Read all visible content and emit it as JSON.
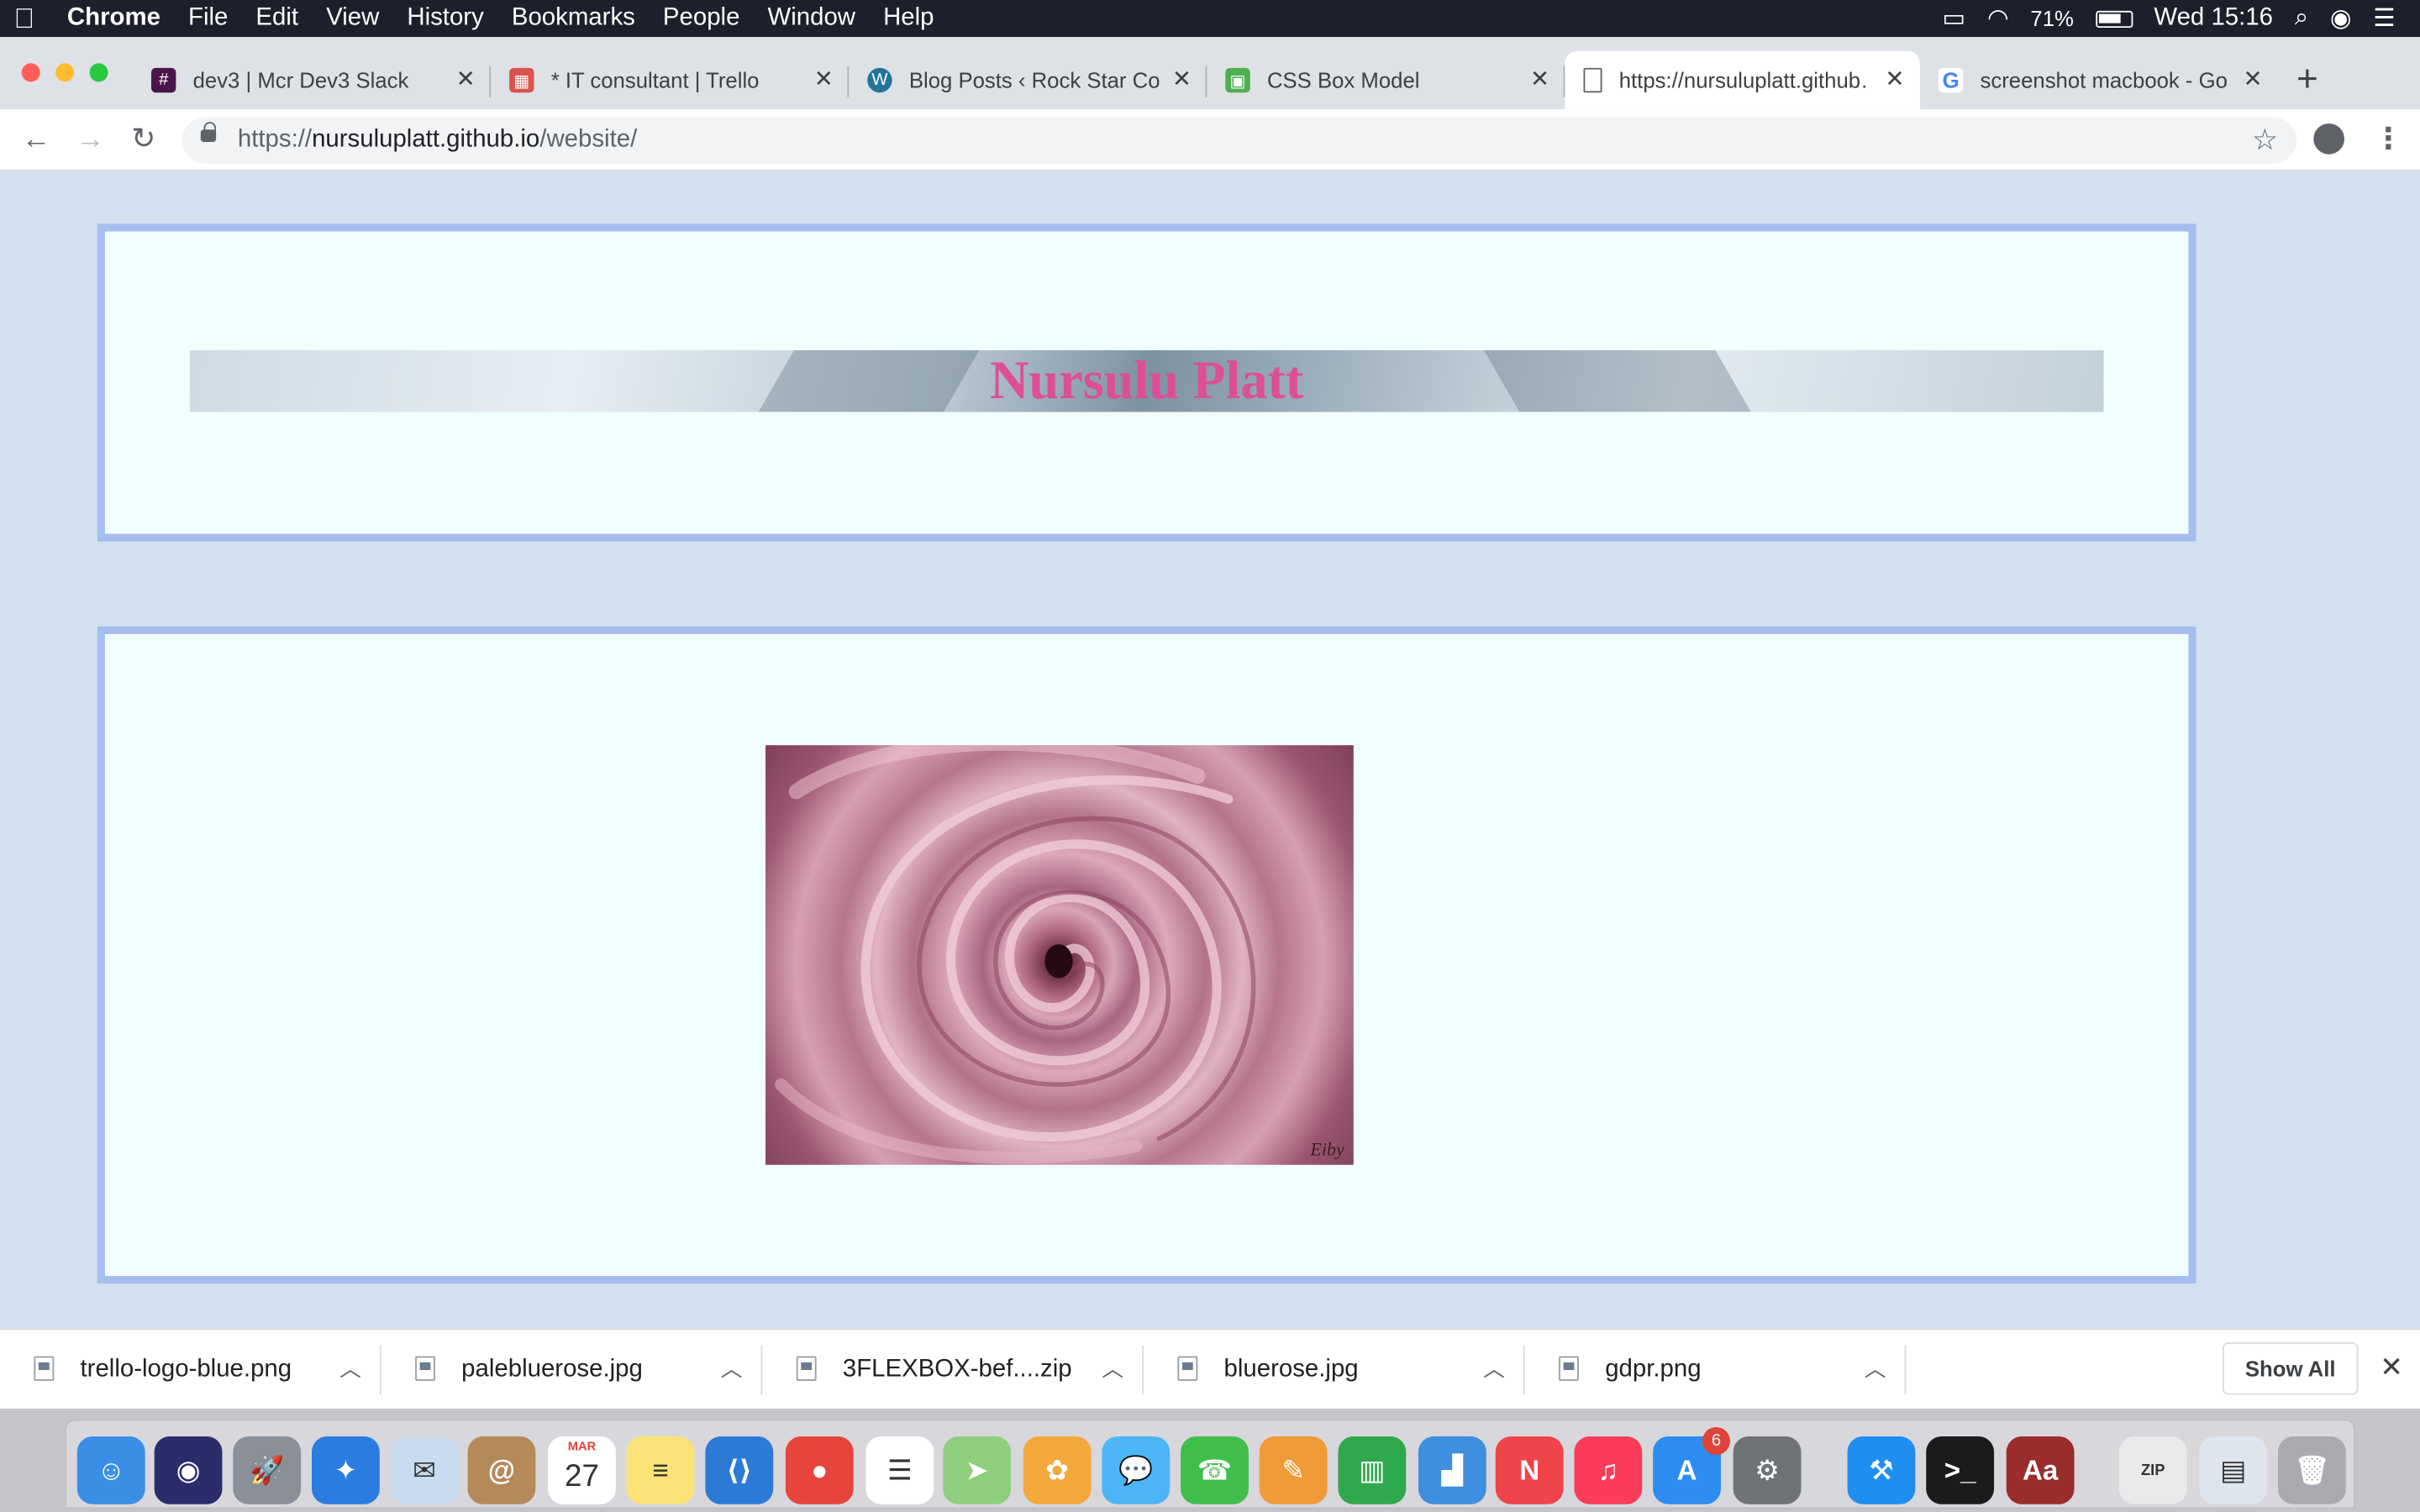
{
  "menubar": {
    "app": "Chrome",
    "items": [
      "File",
      "Edit",
      "View",
      "History",
      "Bookmarks",
      "People",
      "Window",
      "Help"
    ],
    "battery": "71%",
    "clock": "Wed 15:16"
  },
  "tabs": [
    {
      "title": "dev3 | Mcr Dev3 Slack",
      "icon": "slack-icon",
      "color": "#4a154b"
    },
    {
      "title": "* IT consultant | Trello",
      "icon": "trello-icon",
      "color": "#d9534f"
    },
    {
      "title": "Blog Posts ‹ Rock Star Co…",
      "icon": "wordpress-icon",
      "color": "#21759b"
    },
    {
      "title": "CSS Box Model",
      "icon": "box-model-icon",
      "color": "#4caf50"
    },
    {
      "title": "https://nursuluplatt.github…",
      "icon": "page-icon",
      "color": "#9aa0a6"
    },
    {
      "title": "screenshot macbook - Go…",
      "icon": "google-icon",
      "color": "#4285f4"
    }
  ],
  "omnibox": {
    "scheme": "https://",
    "host": "nursuluplatt.github.io",
    "path": "/website/"
  },
  "page": {
    "heading": "Nursulu Platt",
    "image_alt": "pink rose",
    "image_signature": "Eiby"
  },
  "downloads": {
    "items": [
      "trello-logo-blue.png",
      "palebluerose.jpg",
      "3FLEXBOX-bef....zip",
      "bluerose.jpg",
      "gdpr.png"
    ],
    "show_all": "Show All"
  },
  "dock": {
    "items": [
      {
        "name": "finder",
        "color": "#3a8ee6",
        "label": "☺"
      },
      {
        "name": "siri",
        "color": "#2b2d6b",
        "label": "◉"
      },
      {
        "name": "launchpad",
        "color": "#8b8f98",
        "label": "🚀"
      },
      {
        "name": "safari",
        "color": "#2b7ce0",
        "label": "✦"
      },
      {
        "name": "mail",
        "color": "#c9dcef",
        "label": "✉"
      },
      {
        "name": "contacts",
        "color": "#b58a5a",
        "label": "@"
      },
      {
        "name": "calendar",
        "color": "#ffffff",
        "label": "27",
        "month": "MAR"
      },
      {
        "name": "notes",
        "color": "#fbe276",
        "label": "≡"
      },
      {
        "name": "vscode",
        "color": "#2d7ad6",
        "label": "⟨⟩"
      },
      {
        "name": "chrome",
        "color": "#e7453b",
        "label": "●"
      },
      {
        "name": "reminders",
        "color": "#ffffff",
        "label": "☰"
      },
      {
        "name": "maps",
        "color": "#8fce7d",
        "label": "➤"
      },
      {
        "name": "photos",
        "color": "#f3a83c",
        "label": "✿"
      },
      {
        "name": "messages",
        "color": "#4cb5f5",
        "label": "💬"
      },
      {
        "name": "facetime",
        "color": "#3fbf4a",
        "label": "☎"
      },
      {
        "name": "pages",
        "color": "#f19a38",
        "label": "✎"
      },
      {
        "name": "numbers",
        "color": "#2fa94e",
        "label": "▥"
      },
      {
        "name": "keynote",
        "color": "#3f8fe0",
        "label": "▟"
      },
      {
        "name": "news",
        "color": "#f0444a",
        "label": "N"
      },
      {
        "name": "music",
        "color": "#fb3c5b",
        "label": "♫"
      },
      {
        "name": "app-store",
        "color": "#2d8cf0",
        "label": "A",
        "badge": "6"
      },
      {
        "name": "system-preferences",
        "color": "#6f7378",
        "label": "⚙"
      },
      {
        "name": "xcode",
        "color": "#1f8ef1",
        "label": "⚒"
      },
      {
        "name": "terminal",
        "color": "#1b1b1b",
        "label": ">_"
      },
      {
        "name": "dictionary",
        "color": "#9b2c2c",
        "label": "Aa"
      },
      {
        "name": "archive-file",
        "color": "#e9e9ea",
        "label": "ZIP"
      },
      {
        "name": "downloads-stack",
        "color": "#dfe5ec",
        "label": "▤"
      },
      {
        "name": "trash",
        "color": "#a9abb0",
        "label": "🗑"
      }
    ]
  }
}
